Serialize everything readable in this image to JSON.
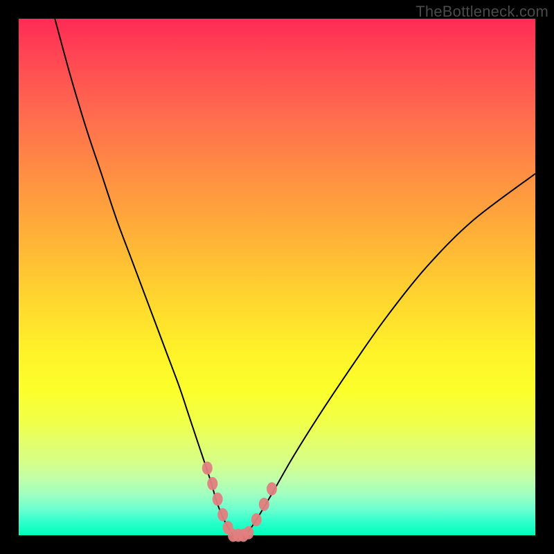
{
  "watermark": "TheBottleneck.com",
  "colors": {
    "background": "#000000",
    "curve": "#000000",
    "marker": "#e28080",
    "gradient_top": "#ff2a55",
    "gradient_bottom": "#00ffb8"
  },
  "chart_data": {
    "type": "line",
    "title": "",
    "xlabel": "",
    "ylabel": "",
    "xlim": [
      0,
      100
    ],
    "ylim": [
      0,
      100
    ],
    "series": [
      {
        "name": "left-curve",
        "x": [
          7,
          10,
          13,
          16,
          19,
          22,
          25,
          28,
          31,
          33,
          35,
          37,
          38.5,
          40,
          41.5
        ],
        "y": [
          100,
          89,
          79,
          70,
          61,
          53,
          45,
          37,
          29,
          23,
          17,
          11,
          6,
          2.5,
          0
        ]
      },
      {
        "name": "right-curve",
        "x": [
          44,
          46,
          49,
          53,
          58,
          64,
          71,
          79,
          88,
          100
        ],
        "y": [
          0,
          3,
          8,
          15,
          23,
          32,
          42,
          52,
          61,
          70
        ]
      },
      {
        "name": "flat-bottom",
        "x": [
          41.5,
          44
        ],
        "y": [
          0,
          0
        ]
      }
    ],
    "markers": {
      "name": "pink-highlight",
      "points": [
        {
          "x": 36.5,
          "y": 13
        },
        {
          "x": 37.5,
          "y": 10
        },
        {
          "x": 38.5,
          "y": 7
        },
        {
          "x": 39.5,
          "y": 4
        },
        {
          "x": 40.5,
          "y": 1.5
        },
        {
          "x": 41.5,
          "y": 0
        },
        {
          "x": 42.5,
          "y": 0
        },
        {
          "x": 43.5,
          "y": 0
        },
        {
          "x": 44.5,
          "y": 0.5
        },
        {
          "x": 46,
          "y": 3
        },
        {
          "x": 47.5,
          "y": 6
        },
        {
          "x": 49,
          "y": 9
        }
      ]
    }
  }
}
